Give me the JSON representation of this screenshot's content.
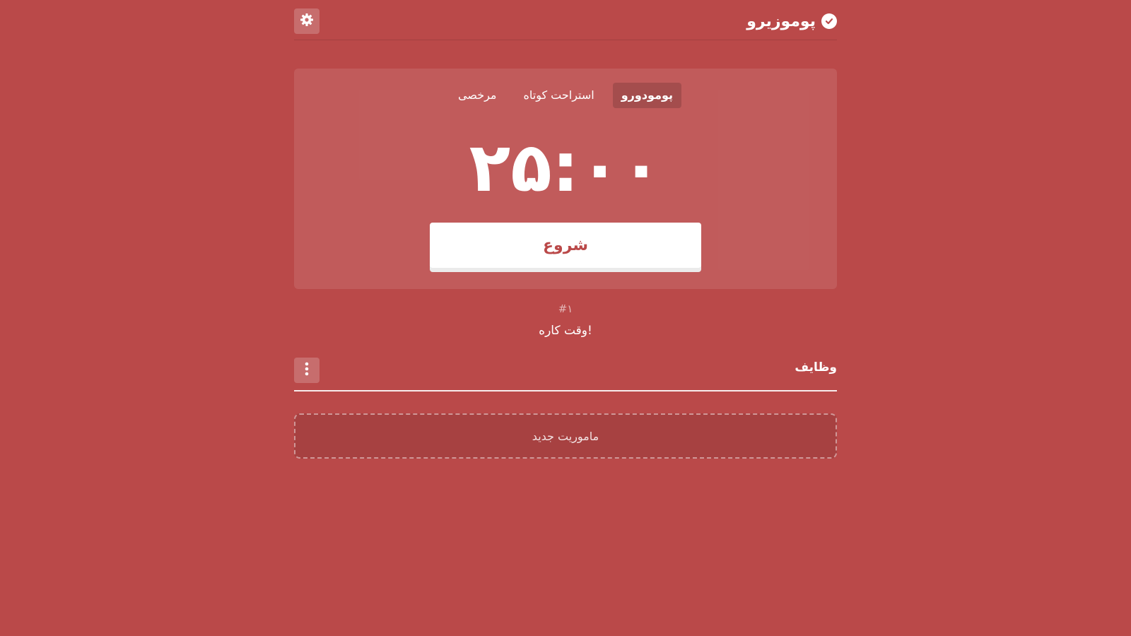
{
  "app": {
    "title": "پوموزیرو",
    "logo_icon": "check-circle-icon",
    "settings_icon": "gear-icon"
  },
  "colors": {
    "background": "#ba4949",
    "card": "rgba(255,255,255,0.1)",
    "accent_text": "#ba4949"
  },
  "tabs": [
    {
      "label": "پومودورو",
      "active": true
    },
    {
      "label": "استراحت کوتاه",
      "active": false
    },
    {
      "label": "مرخصی",
      "active": false
    }
  ],
  "timer": {
    "display": "۲۵:۰۰"
  },
  "start_button": {
    "label": "شروع"
  },
  "session": {
    "count": "#۱",
    "message": "وقت کاره!"
  },
  "tasks": {
    "title": "وظایف",
    "menu_icon": "kebab-menu-icon",
    "add_label": "ماموریت جدید"
  }
}
